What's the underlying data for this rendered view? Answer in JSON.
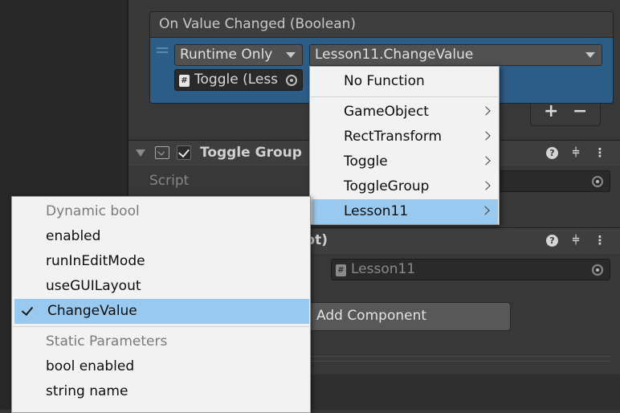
{
  "event": {
    "header": "On Value Changed (Boolean)",
    "runtime_mode": "Runtime Only",
    "function": "Lesson11.ChangeValue",
    "target_object": "Toggle (Less",
    "add_label": "+",
    "remove_label": "−"
  },
  "toggle_group": {
    "title": "Toggle Group",
    "script_label": "Script"
  },
  "lesson_component": {
    "title_partial": "pt)",
    "script_value": "Lesson11"
  },
  "add_component_label": "Add Component",
  "function_menu": {
    "items": [
      {
        "label": "No Function",
        "submenu": false
      },
      {
        "label": "GameObject",
        "submenu": true
      },
      {
        "label": "RectTransform",
        "submenu": true
      },
      {
        "label": "Toggle",
        "submenu": true
      },
      {
        "label": "ToggleGroup",
        "submenu": true
      },
      {
        "label": "Lesson11",
        "submenu": true,
        "highlighted": true
      }
    ]
  },
  "method_menu": {
    "dynamic_header": "Dynamic bool",
    "dynamic_items": [
      "enabled",
      "runInEditMode",
      "useGUILayout",
      "ChangeValue"
    ],
    "selected": "ChangeValue",
    "static_header": "Static Parameters",
    "static_items": [
      "bool enabled",
      "string name"
    ]
  },
  "colors": {
    "event_row_bg": "#2c5d87",
    "menu_highlight": "#99c9ef",
    "menu_bg": "#f2f2f2"
  }
}
